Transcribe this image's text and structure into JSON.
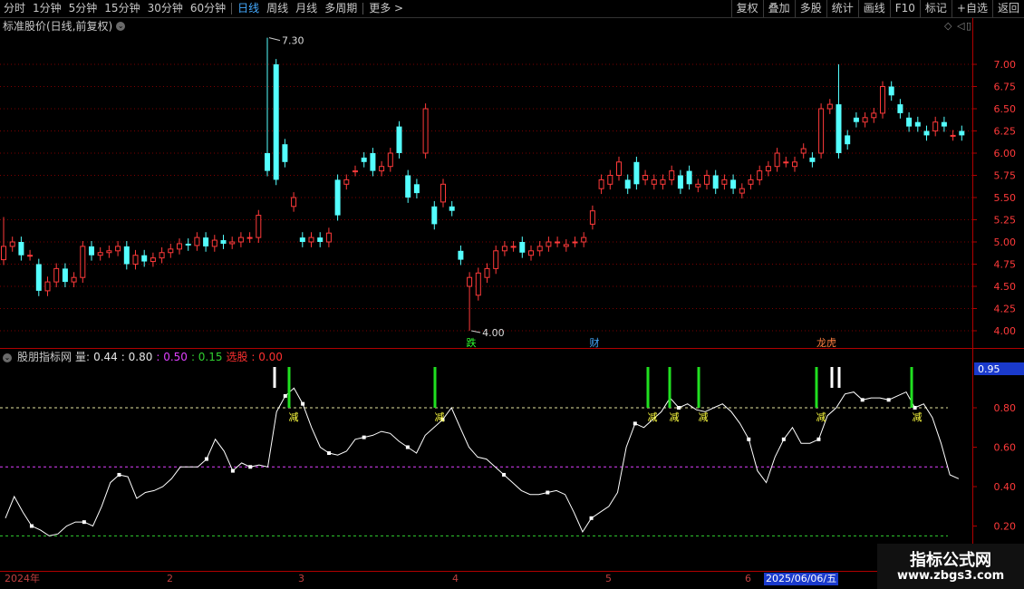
{
  "toolbar": {
    "periods": [
      "分时",
      "1分钟",
      "5分钟",
      "15分钟",
      "30分钟",
      "60分钟",
      "日线",
      "周线",
      "月线",
      "多周期",
      "更多 >"
    ],
    "active_index": 6,
    "right_buttons": [
      "复权",
      "叠加",
      "多股",
      "统计",
      "画线",
      "F10",
      "标记",
      "+自选",
      "返回"
    ]
  },
  "main_chart": {
    "title": "标准股价(日线,前复权)",
    "title_icon": "chevron-down-icon",
    "controls": [
      "◇",
      "◁",
      "▯"
    ],
    "y_ticks": [
      "7.00",
      "6.75",
      "6.50",
      "6.25",
      "6.00",
      "5.75",
      "5.50",
      "5.25",
      "5.00",
      "4.75",
      "4.50",
      "4.25",
      "4.00"
    ],
    "y_values": [
      7.0,
      6.75,
      6.5,
      6.25,
      6.0,
      5.75,
      5.5,
      5.25,
      5.0,
      4.75,
      4.5,
      4.25,
      4.0
    ],
    "high_label": "7.30",
    "low_label": "4.00",
    "markers": [
      {
        "text": "跌",
        "color": "#30ff30"
      },
      {
        "text": "财",
        "color": "#44aaff"
      },
      {
        "text": "龙虎",
        "color": "#ff8040"
      }
    ],
    "colors": {
      "up": "#ff3a3a",
      "down": "#54ffff",
      "grid": "#7a0000"
    }
  },
  "indicator": {
    "name": "股朋指标网",
    "label": "量:",
    "values": [
      "0.44",
      ": 0.80",
      ": 0.50",
      ": 0.15",
      "选股 : 0.00"
    ],
    "value_colors": [
      "#e6e6e6",
      "#e6e6e6",
      "#e040ff",
      "#30d030",
      "#ff3030"
    ],
    "current_value": "0.95",
    "y_ticks": [
      "0.80",
      "0.60",
      "0.40",
      "0.20"
    ],
    "y_values": [
      0.8,
      0.6,
      0.4,
      0.2
    ],
    "signal_label": "减",
    "reference_lines": [
      {
        "value": 0.8,
        "color": "#e6e6a0"
      },
      {
        "value": 0.5,
        "color": "#e040ff"
      },
      {
        "value": 0.15,
        "color": "#30d030"
      }
    ]
  },
  "x_axis": {
    "labels": [
      "2024年",
      "2",
      "3",
      "4",
      "5",
      "6"
    ],
    "date_box": "2025/06/06/五"
  },
  "watermark": {
    "line1": "指标公式网",
    "line2": "www.zbgs3.com"
  }
}
